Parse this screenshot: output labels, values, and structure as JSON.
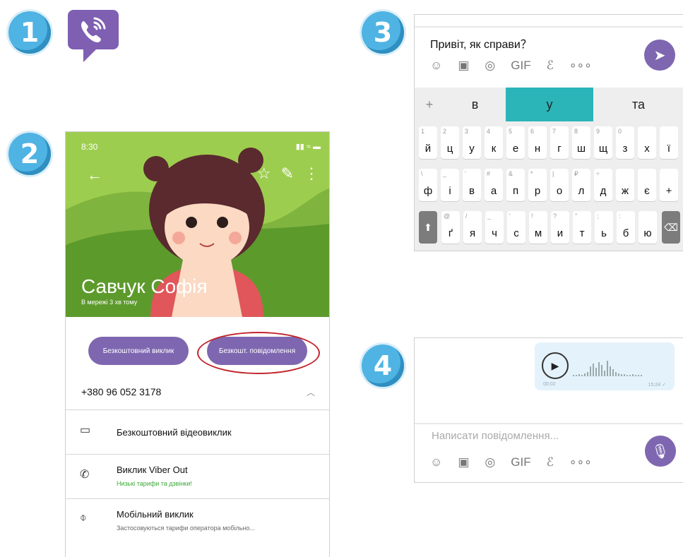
{
  "steps": [
    "1",
    "2",
    "3",
    "4"
  ],
  "logo": {
    "icon": "viber-logo-icon",
    "color": "#7e5fb2"
  },
  "profile": {
    "time": "8:30",
    "status": "▮▮ ≈ ▬",
    "name": "Савчук Софія",
    "subtitle": "В мережі 3 хв тому",
    "call_button": "Безкоштовний виклик",
    "message_button": "Безкошт. повідомлення",
    "phone": "+380 96 052 3178",
    "options": [
      {
        "title": "Безкоштовний відеовиклик",
        "sub": ""
      },
      {
        "title": "Виклик Viber Out",
        "sub": "Низькі тарифи та дзвінки!"
      },
      {
        "title": "Мобільний виклик",
        "sub": "Застосовуються тарифи оператора мобільно..."
      }
    ]
  },
  "compose": {
    "message": "Привіт, як справи？",
    "suggestions": [
      "+",
      "в",
      "у",
      "та"
    ],
    "rows": [
      [
        [
          "1",
          "й"
        ],
        [
          "2",
          "ц"
        ],
        [
          "3",
          "у"
        ],
        [
          "4",
          "к"
        ],
        [
          "5",
          "е"
        ],
        [
          "6",
          "н"
        ],
        [
          "7",
          "г"
        ],
        [
          "8",
          "ш"
        ],
        [
          "9",
          "щ"
        ],
        [
          "0",
          "з"
        ],
        [
          "",
          "х"
        ],
        [
          "",
          "ї"
        ]
      ],
      [
        [
          "\\",
          "ф"
        ],
        [
          "_",
          "і"
        ],
        [
          "'",
          "в"
        ],
        [
          "#",
          "а"
        ],
        [
          "&",
          "п"
        ],
        [
          "*",
          "р"
        ],
        [
          "|",
          "о"
        ],
        [
          "₽",
          "л"
        ],
        [
          "÷",
          "д"
        ],
        [
          "",
          "ж"
        ],
        [
          "",
          "є"
        ],
        [
          "",
          "+"
        ]
      ],
      [
        [
          "@",
          "ґ"
        ],
        [
          "/",
          "я"
        ],
        [
          "_",
          "ч"
        ],
        [
          "'",
          "с"
        ],
        [
          "!",
          "м"
        ],
        [
          "?",
          "и"
        ],
        [
          "\"",
          "т"
        ],
        [
          ";",
          "ь"
        ],
        [
          ":",
          "б"
        ],
        [
          "",
          "ю"
        ]
      ]
    ]
  },
  "voice": {
    "start": "00:02",
    "time": "15:24 ✓",
    "placeholder": "Написати повідомлення..."
  },
  "colors": {
    "accent": "#7e67b0",
    "green": "#9dcd4e",
    "teal": "#2cb5b8",
    "step": "#4fb3e3"
  }
}
